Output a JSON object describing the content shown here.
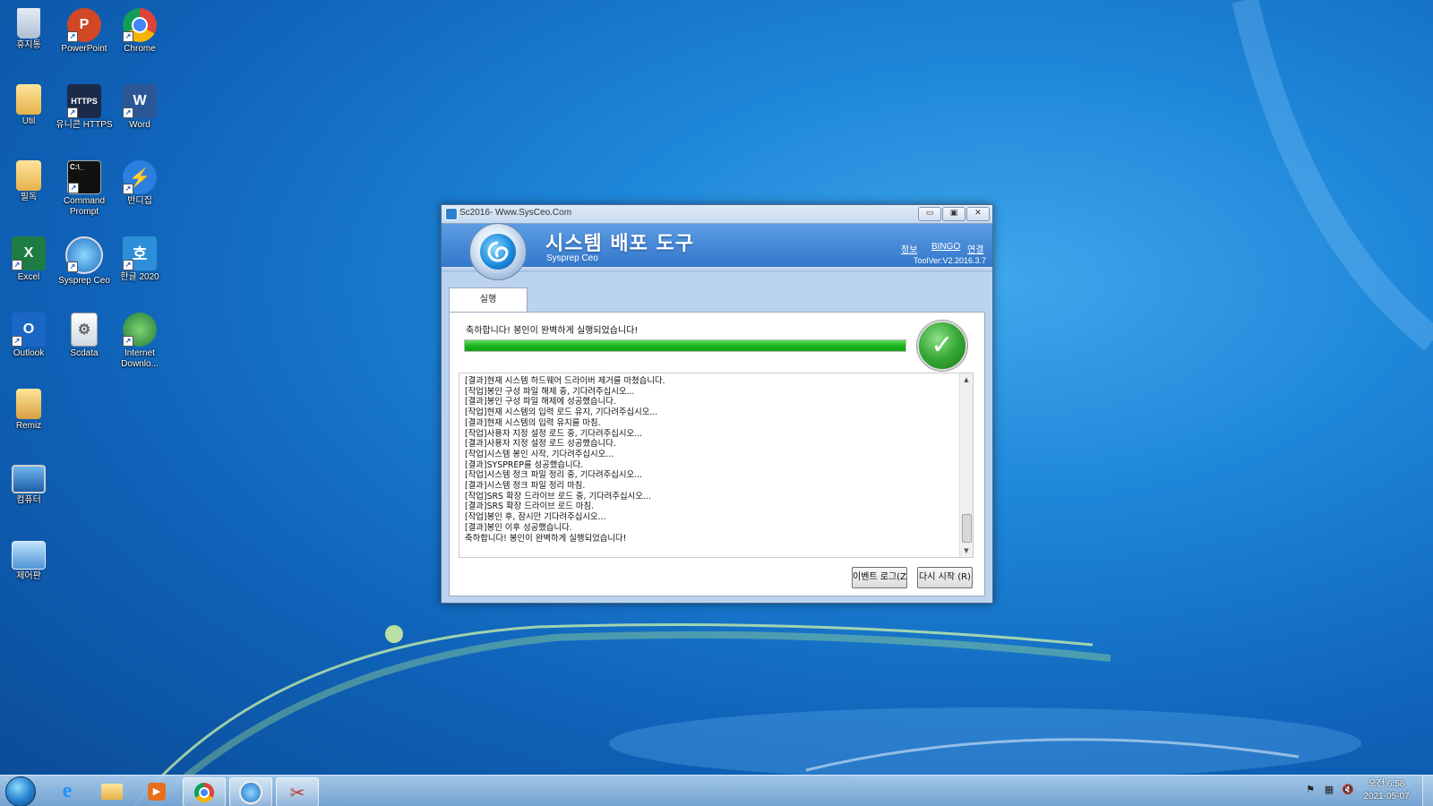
{
  "desktop": {
    "icons": [
      {
        "label": "휴지통",
        "icon": "recycle-bin-icon"
      },
      {
        "label": "PowerPoint",
        "icon": "powerpoint-icon"
      },
      {
        "label": "Chrome",
        "icon": "chrome-icon"
      },
      {
        "label": "Util",
        "icon": "folder-icon"
      },
      {
        "label": "유니콘 HTTPS",
        "icon": "unicorn-https-icon"
      },
      {
        "label": "Word",
        "icon": "word-icon"
      },
      {
        "label": "필독",
        "icon": "folder-icon"
      },
      {
        "label": "Command Prompt",
        "icon": "command-prompt-icon"
      },
      {
        "label": "반디집",
        "icon": "bandizip-icon"
      },
      {
        "label": "Excel",
        "icon": "excel-icon"
      },
      {
        "label": "Sysprep Ceo",
        "icon": "sysprep-ceo-icon"
      },
      {
        "label": "한글 2020",
        "icon": "hangul-2020-icon"
      },
      {
        "label": "Outlook",
        "icon": "outlook-icon"
      },
      {
        "label": "Scdata",
        "icon": "scdata-icon"
      },
      {
        "label": "Internet Downlo...",
        "icon": "internet-download-manager-icon"
      },
      {
        "label": "Remiz",
        "icon": "remiz-folder-icon"
      },
      {
        "label": "컴퓨터",
        "icon": "computer-icon"
      },
      {
        "label": "제어판",
        "icon": "control-panel-icon"
      }
    ]
  },
  "window": {
    "title": "Sc2016- Www.SysCeo.Com",
    "controls": {
      "minimize": "▭",
      "maximize": "▣",
      "close": "✕"
    },
    "header": {
      "title": "시스템 배포 도구",
      "subtitle": "Sysprep  Ceo",
      "links": [
        "정보",
        "BINGO",
        "연결"
      ],
      "version": "ToolVer:V2.2016.3.7"
    },
    "tab": "실행",
    "status": "축하합니다! 봉인이 완벽하게 실행되었습니다!",
    "progress": 1.0,
    "log": [
      "[결과]현재 시스템 하드웨어 드라이버  제거를 마쳤습니다.",
      "[작업]봉인 구성 파일 해제 중, 기다려주십시오...",
      "[결과]봉인 구성 파일 해제에 성공했습니다.",
      "[작업]현재 시스템의 입력 로드 유지, 기다려주십시오...",
      "[결과]현재 시스템의 입력 유지를 마침.",
      "[작업]사용자 지정 설정 로드 중, 기다려주십시오...",
      "[결과]사용자 지정 설정 로드 성공했습니다.",
      "[작업]시스템 봉인 시작, 기다려주십시오...",
      "[결과]SYSPREP를 성공했습니다.",
      "[작업]시스템 정크 파일 정리 중, 기다려주십시오...",
      "[결과]시스템 정크 파일 정리 마침.",
      "[작업]SRS 확장 드라이브 로드 중, 기다려주십시오...",
      "[결과]SRS 확장 드라이브 로드 마침.",
      "[작업]봉인 후, 잠시만 기다려주십시오...",
      "[결과]봉인 이후 성공했습니다.",
      "축하합니다! 봉인이 완벽하게 실행되었습니다!"
    ],
    "buttons": {
      "event_log": "이벤트 로그(Z)",
      "restart": "다시 시작 (R)"
    }
  },
  "taskbar": {
    "clock_time": "오전 6:58",
    "clock_date": "2021-05-07"
  },
  "colors": {
    "accent": "#2f72c7",
    "progress": "#1db41d",
    "desktop": "#1e86d8"
  }
}
